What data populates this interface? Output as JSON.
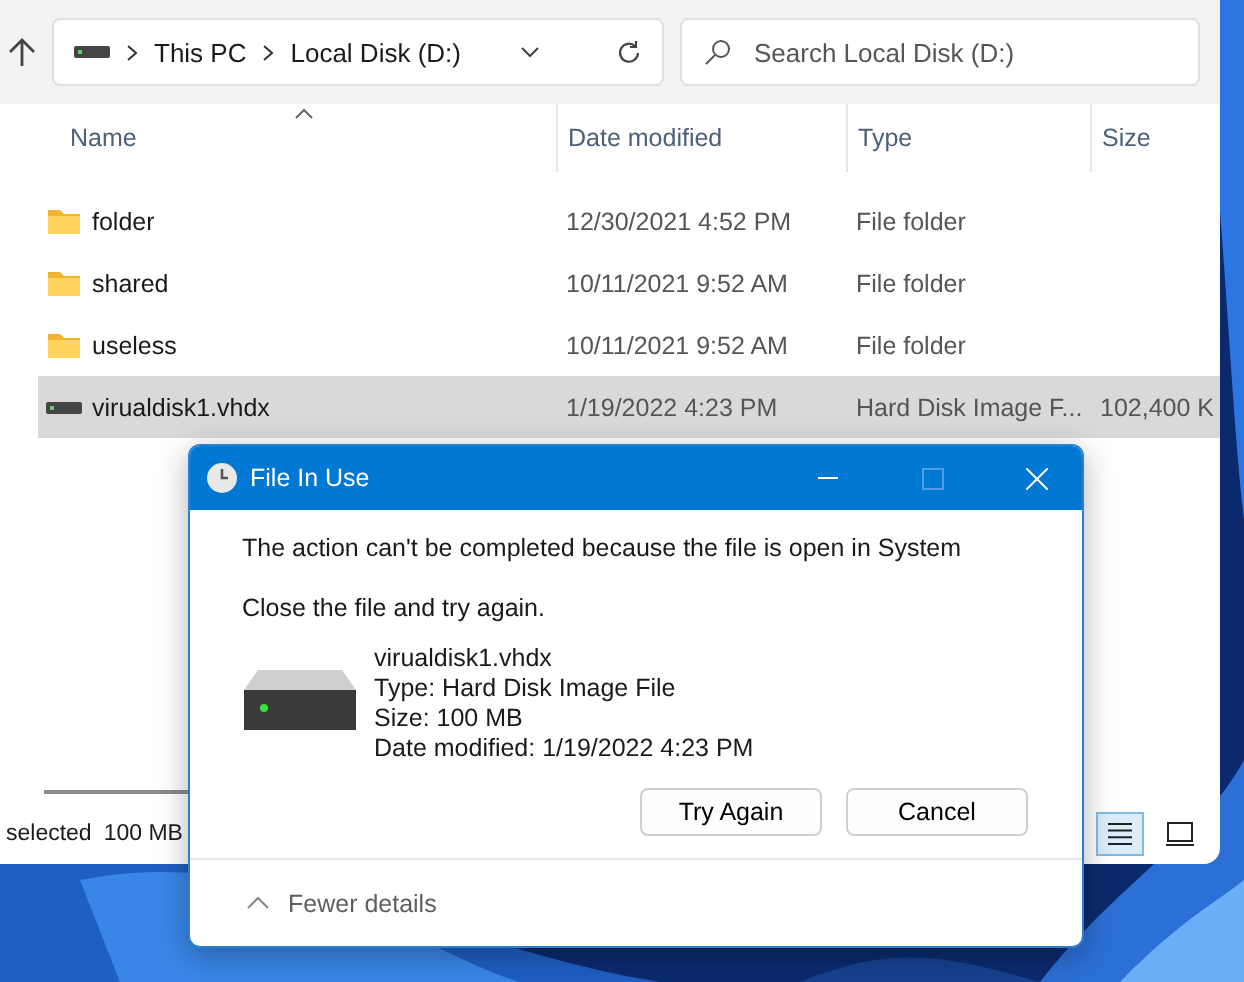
{
  "explorer": {
    "address": {
      "path": [
        "This PC",
        "Local Disk (D:)"
      ]
    },
    "search": {
      "placeholder": "Search Local Disk (D:)"
    },
    "columns": [
      {
        "label": "Name",
        "sorted": true
      },
      {
        "label": "Date modified",
        "sorted": false
      },
      {
        "label": "Type",
        "sorted": false
      },
      {
        "label": "Size",
        "sorted": false
      }
    ],
    "rows": [
      {
        "kind": "folder",
        "name": "folder",
        "date": "12/30/2021 4:52 PM",
        "type": "File folder",
        "selected": false
      },
      {
        "kind": "folder",
        "name": "shared",
        "date": "10/11/2021 9:52 AM",
        "type": "File folder",
        "selected": false
      },
      {
        "kind": "folder",
        "name": "useless",
        "date": "10/11/2021 9:52 AM",
        "type": "File folder",
        "selected": false
      },
      {
        "kind": "disk",
        "name": "virualdisk1.vhdx",
        "date": "1/19/2022 4:23 PM",
        "type": "Hard Disk Image F...",
        "size": "102,400 K",
        "selected": true
      }
    ],
    "status_bar": {
      "selection": "selected",
      "size": "100 MB"
    },
    "view_buttons": [
      {
        "kind": "details",
        "selected": true
      },
      {
        "kind": "tiles",
        "selected": false
      }
    ]
  },
  "dialog": {
    "title": "File In Use",
    "message": "The action can't be completed because the file is open in System",
    "instruction": "Close the file and try again.",
    "file": {
      "name": "virualdisk1.vhdx",
      "type": "Type: Hard Disk Image File",
      "size": "Size: 100 MB",
      "date": "Date modified: 1/19/2022 4:23 PM"
    },
    "buttons": [
      "Try Again",
      "Cancel"
    ],
    "details_toggle": {
      "label": "Fewer details",
      "expanded": true
    }
  }
}
